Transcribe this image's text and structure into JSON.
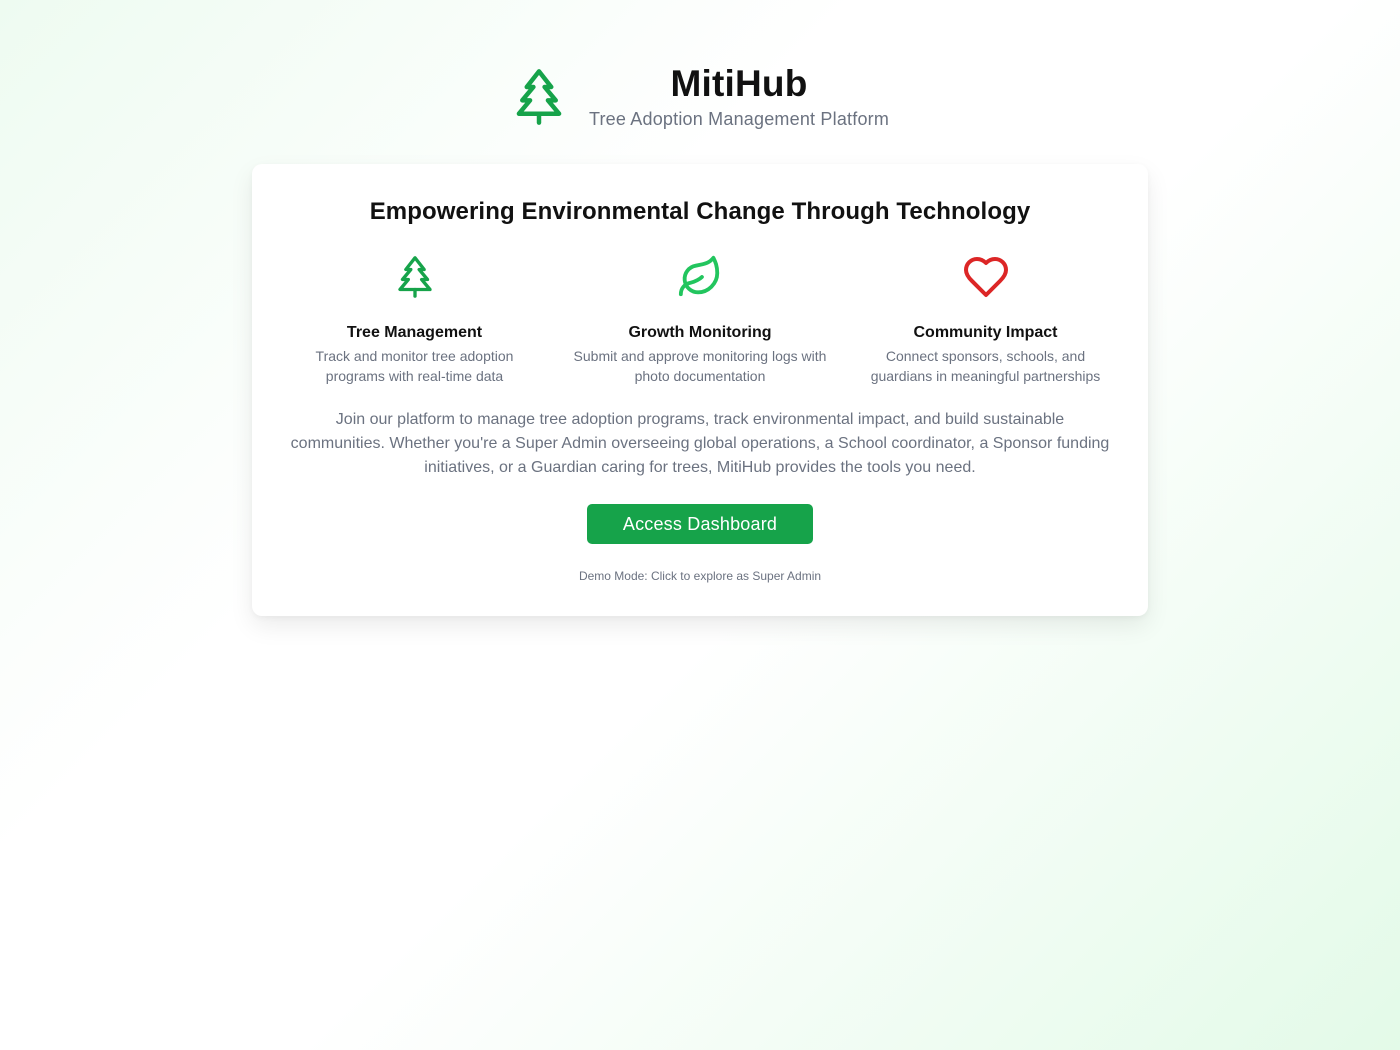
{
  "header": {
    "logo_icon": "tree-pine-icon",
    "title": "MitiHub",
    "subtitle": "Tree Adoption Management Platform"
  },
  "card": {
    "heading": "Empowering Environmental Change Through Technology",
    "features": [
      {
        "icon": "tree-pine-icon",
        "icon_color": "#16a34a",
        "title": "Tree Management",
        "description": "Track and monitor tree adoption programs with real-time data"
      },
      {
        "icon": "leaf-icon",
        "icon_color": "#22c55e",
        "title": "Growth Monitoring",
        "description": "Submit and approve monitoring logs with photo documentation"
      },
      {
        "icon": "heart-icon",
        "icon_color": "#dc2626",
        "title": "Community Impact",
        "description": "Connect sponsors, schools, and guardians in meaningful partnerships"
      }
    ],
    "intro": "Join our platform to manage tree adoption programs, track environmental impact, and build sustainable communities. Whether you're a Super Admin overseeing global operations, a School coordinator, a Sponsor funding initiatives, or a Guardian caring for trees, MitiHub provides the tools you need.",
    "cta_label": "Access Dashboard",
    "demo_note": "Demo Mode: Click to explore as Super Admin"
  },
  "colors": {
    "brand_green": "#16a34a",
    "muted_text": "#6b7280",
    "heart_red": "#dc2626"
  }
}
